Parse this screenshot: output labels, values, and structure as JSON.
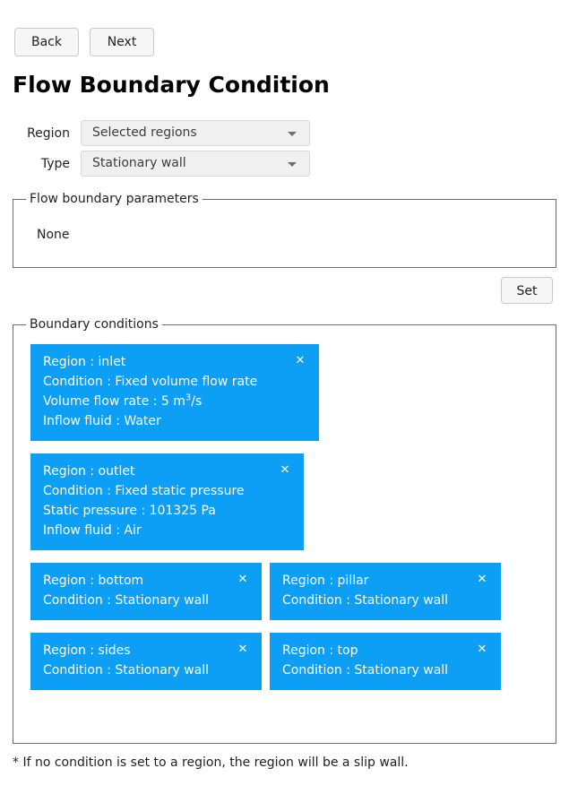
{
  "nav": {
    "back_label": "Back",
    "next_label": "Next"
  },
  "page": {
    "title": "Flow Boundary Condition",
    "footnote": "* If no condition is set to a region, the region will be a slip wall."
  },
  "form": {
    "region": {
      "label": "Region",
      "value": "Selected regions"
    },
    "type": {
      "label": "Type",
      "value": "Stationary wall"
    }
  },
  "parameters_group": {
    "legend": "Flow boundary parameters",
    "content": "None"
  },
  "actions": {
    "set_label": "Set"
  },
  "boundary_group": {
    "legend": "Boundary conditions",
    "close_glyph": "✕",
    "accent_color": "#0d9ef5",
    "cards": [
      {
        "region": "Region : inlet",
        "condition": "Condition : Fixed volume flow rate",
        "detail_prefix": "Volume flow rate : 5 m",
        "detail_sup": "3",
        "detail_suffix": "/s",
        "fluid": "Inflow fluid : Water"
      },
      {
        "region": "Region : outlet",
        "condition": "Condition : Fixed static pressure",
        "detail": "Static pressure : 101325 Pa",
        "fluid": "Inflow fluid : Air"
      },
      {
        "region": "Region : bottom",
        "condition": "Condition : Stationary wall"
      },
      {
        "region": "Region : pillar",
        "condition": "Condition : Stationary wall"
      },
      {
        "region": "Region : sides",
        "condition": "Condition : Stationary wall"
      },
      {
        "region": "Region : top",
        "condition": "Condition : Stationary wall"
      }
    ]
  }
}
